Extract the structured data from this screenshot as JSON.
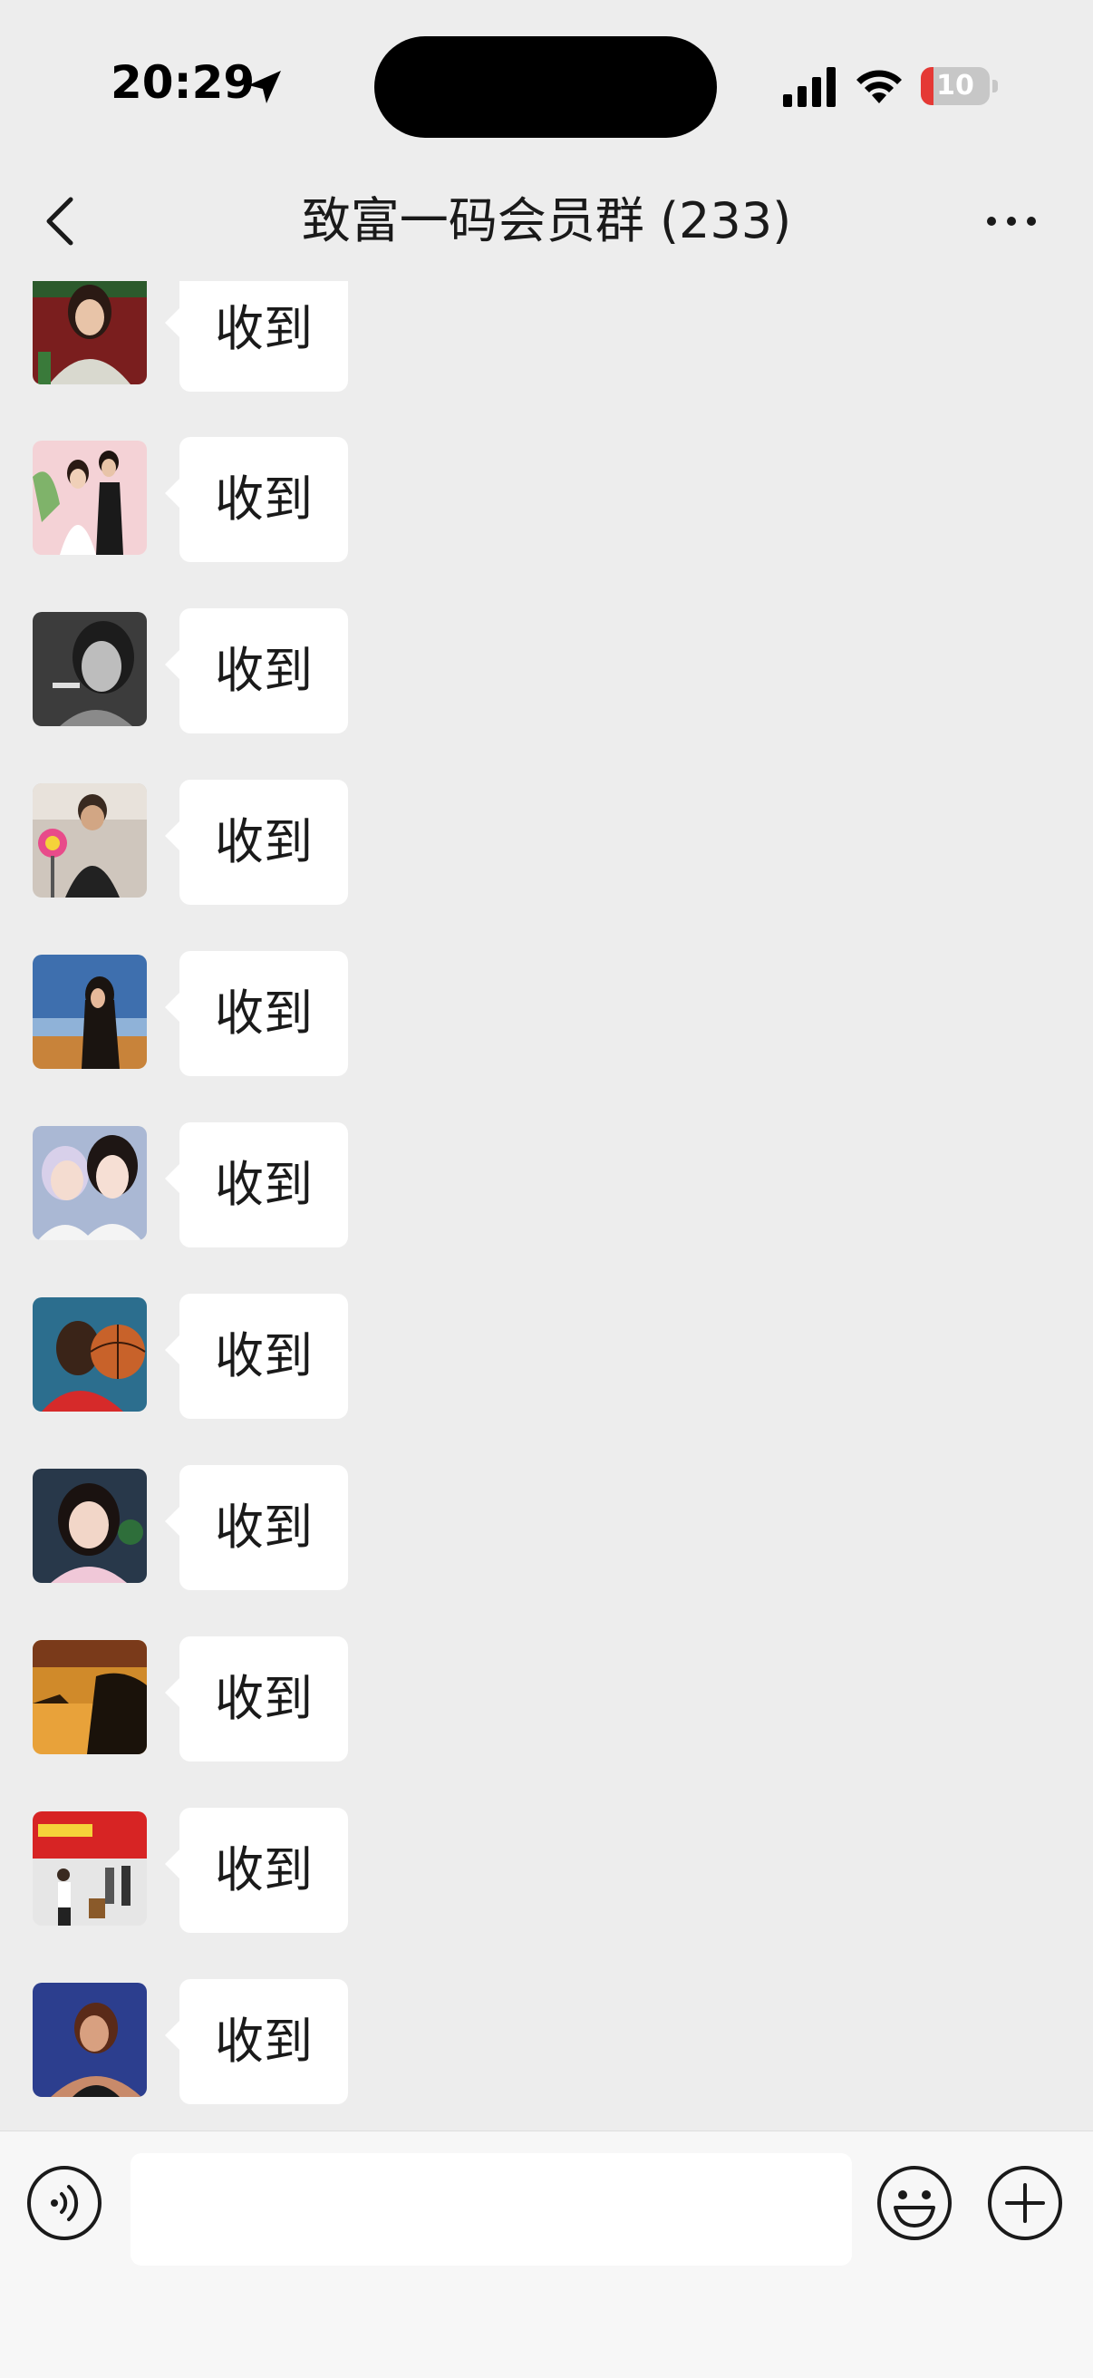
{
  "status_bar": {
    "time": "20:29",
    "battery_level": "10",
    "battery_percent": 10
  },
  "header": {
    "title": "致富一码会员群 (233)"
  },
  "messages": [
    {
      "text": "收到",
      "avatar": "avatar-woman-red-background"
    },
    {
      "text": "收到",
      "avatar": "avatar-wedding-couple"
    },
    {
      "text": "收到",
      "avatar": "avatar-black-white-portrait"
    },
    {
      "text": "收到",
      "avatar": "avatar-man-with-pinwheel"
    },
    {
      "text": "收到",
      "avatar": "avatar-woman-at-sunset-lake"
    },
    {
      "text": "收到",
      "avatar": "avatar-two-girls-cat-filter"
    },
    {
      "text": "收到",
      "avatar": "avatar-man-with-basketball"
    },
    {
      "text": "收到",
      "avatar": "avatar-smiling-girl"
    },
    {
      "text": "收到",
      "avatar": "avatar-sunset-landscape"
    },
    {
      "text": "收到",
      "avatar": "avatar-group-event-red-banner"
    },
    {
      "text": "收到",
      "avatar": "avatar-woman-blue-background"
    }
  ],
  "input": {
    "value": "",
    "placeholder": ""
  },
  "colors": {
    "background": "#ededed",
    "bubble": "#ffffff",
    "battery_low": "#e53935"
  }
}
